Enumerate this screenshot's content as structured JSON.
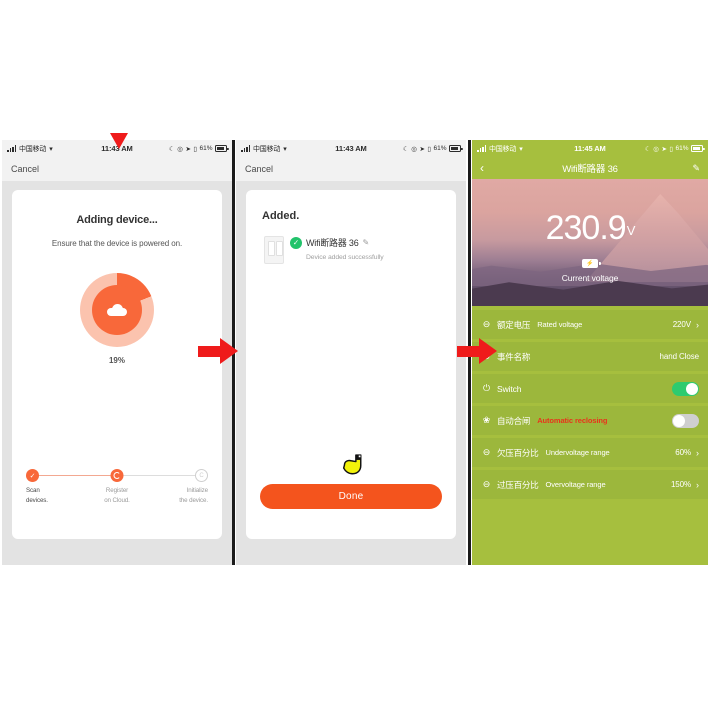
{
  "status_bar": {
    "carrier": "中国移动",
    "time_1": "11:43 AM",
    "time_2": "11:43 AM",
    "time_3": "11:45 AM",
    "battery_pct": "61%",
    "icons": [
      "signal-bars-icon",
      "wifi-icon",
      "moon-icon",
      "alarm-icon",
      "location-arrow-icon",
      "lock-icon",
      "battery-icon"
    ]
  },
  "phone1": {
    "nav": {
      "cancel_label": "Cancel"
    },
    "title": "Adding device...",
    "subtitle": "Ensure that the device is powered on.",
    "progress_pct": "19%",
    "progress_value": 19,
    "steps": [
      {
        "label": "Scan\ndevices.",
        "label_line1": "Scan",
        "label_line2": "devices.",
        "state": "done"
      },
      {
        "label": "Register on Cloud.",
        "label_line1": "Register",
        "label_line2": "on Cloud.",
        "state": "active"
      },
      {
        "label": "Initialize the device.",
        "label_line1": "Initialize",
        "label_line2": "the device.",
        "state": "pending"
      }
    ]
  },
  "phone2": {
    "nav": {
      "cancel_label": "Cancel"
    },
    "heading": "Added.",
    "device_name": "Wifi断路器 36",
    "device_status": "Device added successfully",
    "done_label": "Done",
    "check_glyph": "✓",
    "edit_glyph": "✎"
  },
  "phone3": {
    "nav": {
      "back_glyph": "‹",
      "title": "Wifi断路器 36",
      "edit_glyph": "✎"
    },
    "hero": {
      "voltage_value": "230.9",
      "voltage_unit": "V",
      "caption": "Current voltage",
      "badge_glyph": "⚡"
    },
    "rows": [
      {
        "icon": "minus-circle-icon",
        "glyph": "⊖",
        "cn": "额定电压",
        "en": "Rated voltage",
        "value": "220V",
        "control": "chevron",
        "alert": false
      },
      {
        "icon": "minus-circle-icon",
        "glyph": "⊖",
        "cn": "事件名称",
        "en": "",
        "value": "hand Close",
        "control": "value",
        "alert": false
      },
      {
        "icon": "power-icon",
        "glyph": "⏻",
        "cn": "",
        "en": "Switch",
        "value": "",
        "control": "toggle-on",
        "alert": false
      },
      {
        "icon": "fan-circle-icon",
        "glyph": "❀",
        "cn": "自动合闸",
        "en": "Automatic reclosing",
        "value": "",
        "control": "toggle-off",
        "alert": true
      },
      {
        "icon": "minus-circle-icon",
        "glyph": "⊖",
        "cn": "欠压百分比",
        "en": "Undervoltage range",
        "value": "60%",
        "control": "chevron",
        "alert": false
      },
      {
        "icon": "minus-circle-icon",
        "glyph": "⊖",
        "cn": "过压百分比",
        "en": "Overvoltage range",
        "value": "150%",
        "control": "chevron",
        "alert": false
      }
    ],
    "chevron_glyph": "›"
  },
  "colors": {
    "accent_orange": "#f4541d",
    "green_header": "#a6bf3e",
    "row_green": "#9cb73c",
    "toggle_on": "#2ecb6f",
    "alert_red": "#e8341c",
    "arrow_red": "#ef1b1b",
    "check_green": "#22c36b"
  }
}
